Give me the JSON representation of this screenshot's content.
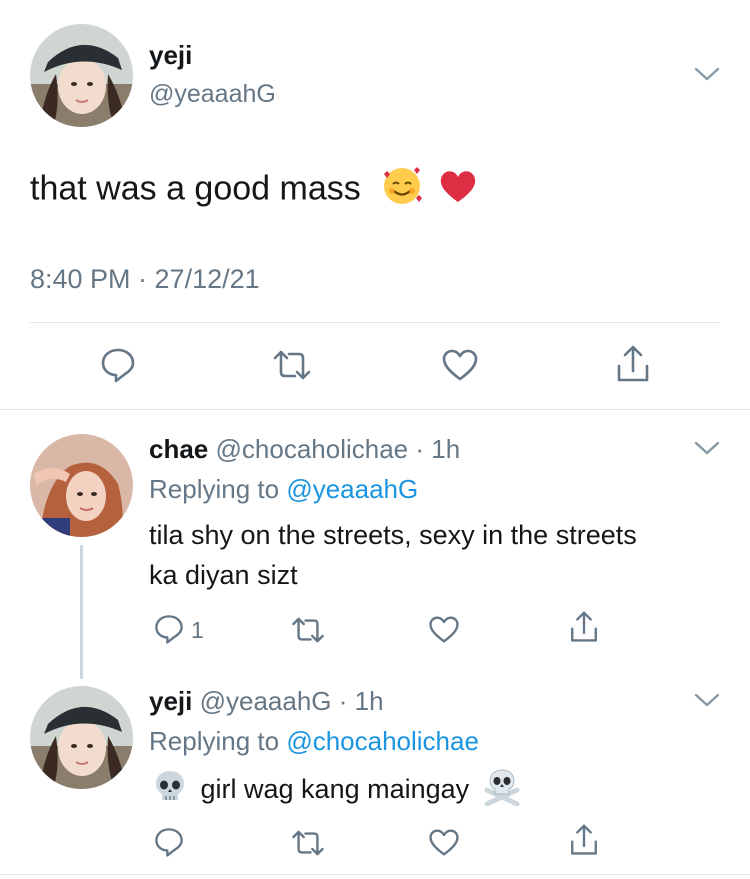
{
  "main_tweet": {
    "display_name": "yeji",
    "handle": "@yeaaahG",
    "text": "that was a good mass",
    "emojis": [
      "smiling-face-with-hearts",
      "red-heart"
    ],
    "timestamp": "8:40 PM · 27/12/21"
  },
  "replies": [
    {
      "display_name": "chae",
      "handle": "@chocaholichae",
      "time": "· 1h",
      "replying_prefix": "Replying to",
      "replying_to": "@yeaaahG",
      "text_line1": "tila shy on the streets, sexy in the streets",
      "text_line2": "ka diyan sizt",
      "reply_count": "1"
    },
    {
      "display_name": "yeji",
      "handle": "@yeaaahG",
      "time": "· 1h",
      "replying_prefix": "Replying to",
      "replying_to": "@chocaholichae",
      "text": "girl wag kang maingay",
      "emojis": [
        "skull",
        "skull-and-crossbones"
      ]
    }
  ],
  "icons": [
    "chevron-down-icon",
    "reply-icon",
    "retweet-icon",
    "like-icon",
    "share-icon"
  ],
  "colors": {
    "text": "#14171a",
    "muted": "#657786",
    "link": "#1b95e0",
    "divider": "#e1e8ed",
    "heart": "#e0245e"
  }
}
